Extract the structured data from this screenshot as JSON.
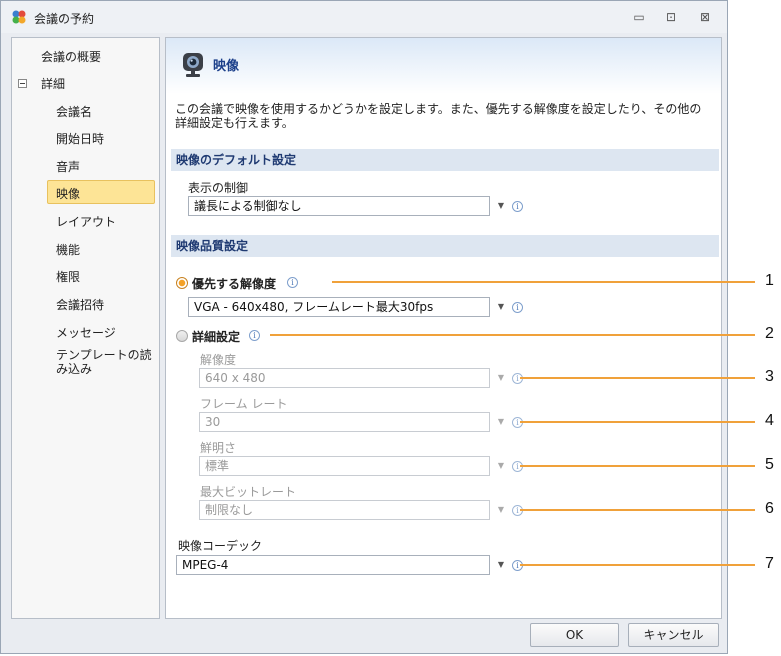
{
  "window": {
    "title": "会議の予約",
    "minimize": "▭",
    "maximize": "⊡",
    "close": "⊠"
  },
  "sidebar": {
    "items": [
      {
        "label": "会議の概要"
      },
      {
        "label": "詳細"
      },
      {
        "label": "会議名"
      },
      {
        "label": "開始日時"
      },
      {
        "label": "音声"
      },
      {
        "label": "映像"
      },
      {
        "label": "レイアウト"
      },
      {
        "label": "機能"
      },
      {
        "label": "権限"
      },
      {
        "label": "会議招待"
      },
      {
        "label": "メッセージ"
      },
      {
        "label": "テンプレートの読み込み"
      }
    ],
    "selected": "映像"
  },
  "content": {
    "title": "映像",
    "description": "この会議で映像を使用するかどうかを設定します。また、優先する解像度を設定したり、その他の詳細設定も行えます。",
    "group_default": "映像のデフォルト設定",
    "display_control_label": "表示の制御",
    "display_control_value": "議長による制御なし",
    "group_quality": "映像品質設定",
    "preferred_resolution_label": "優先する解像度",
    "preferred_resolution_value": "VGA - 640x480, フレームレート最大30fps",
    "advanced_label": "詳細設定",
    "resolution_label": "解像度",
    "resolution_value": "640 x 480",
    "framerate_label": "フレーム レート",
    "framerate_value": "30",
    "sharpness_label": "鮮明さ",
    "sharpness_value": "標準",
    "max_bitrate_label": "最大ビットレート",
    "max_bitrate_value": "制限なし",
    "codec_label": "映像コーデック",
    "codec_value": "MPEG-4",
    "info_glyph": "i",
    "dropdown_glyph": "▼"
  },
  "buttons": {
    "ok": "OK",
    "cancel": "キャンセル"
  },
  "callouts": [
    "1",
    "2",
    "3",
    "4",
    "5",
    "6",
    "7"
  ],
  "colors": {
    "callout": "#f0a13a",
    "selected": "#fde496",
    "group_bar": "#dde6f1",
    "title_blue": "#1b3f8a"
  }
}
